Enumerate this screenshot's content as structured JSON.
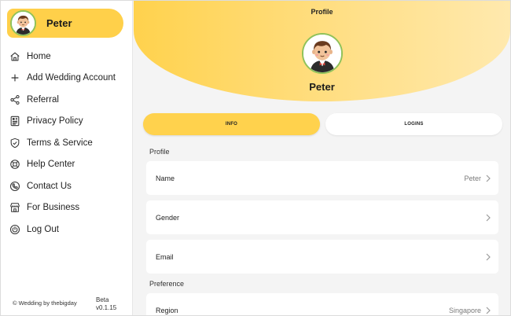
{
  "sidebar": {
    "user_name": "Peter",
    "menu": [
      {
        "label": "Home",
        "icon": "home-icon"
      },
      {
        "label": "Add Wedding Account",
        "icon": "plus-icon"
      },
      {
        "label": "Referral",
        "icon": "share-icon"
      },
      {
        "label": "Privacy Policy",
        "icon": "document-icon"
      },
      {
        "label": "Terms & Service",
        "icon": "shield-icon"
      },
      {
        "label": "Help Center",
        "icon": "lifebuoy-icon"
      },
      {
        "label": "Contact Us",
        "icon": "phone-icon"
      },
      {
        "label": "For Business",
        "icon": "storefront-icon"
      },
      {
        "label": "Log Out",
        "icon": "power-icon"
      }
    ],
    "footer_text": "© Wedding by thebigday",
    "version_badge": "Beta",
    "version_number": "v0.1.15"
  },
  "header": {
    "title": "Profile",
    "user_name": "Peter"
  },
  "tabs": [
    {
      "label": "INFO",
      "active": true
    },
    {
      "label": "LOGINS",
      "active": false
    }
  ],
  "sections": {
    "profile_label": "Profile",
    "preference_label": "Preference"
  },
  "profile_rows": [
    {
      "label": "Name",
      "value": "Peter"
    },
    {
      "label": "Gender",
      "value": ""
    },
    {
      "label": "Email",
      "value": ""
    }
  ],
  "preference_rows": [
    {
      "label": "Region",
      "value": "Singapore"
    }
  ],
  "colors": {
    "accent": "#ffd04a",
    "avatar_ring": "#8fc25a",
    "background": "#f4f4f4"
  }
}
